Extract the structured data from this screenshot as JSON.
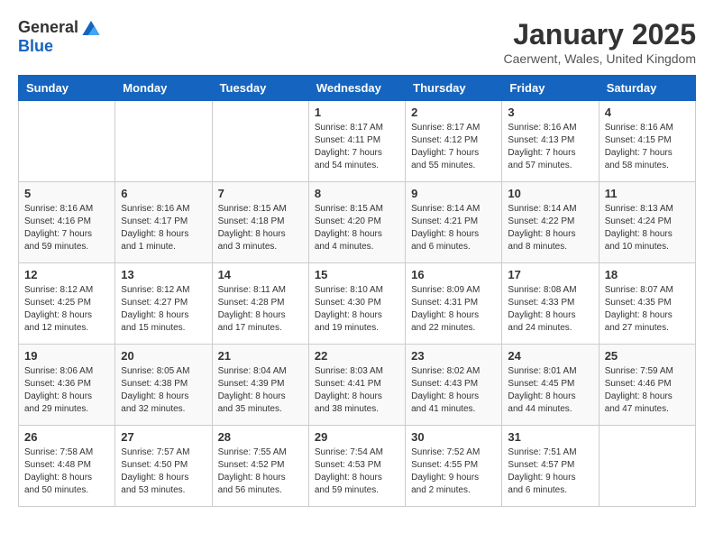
{
  "logo": {
    "general": "General",
    "blue": "Blue"
  },
  "title": "January 2025",
  "location": "Caerwent, Wales, United Kingdom",
  "days_of_week": [
    "Sunday",
    "Monday",
    "Tuesday",
    "Wednesday",
    "Thursday",
    "Friday",
    "Saturday"
  ],
  "weeks": [
    [
      {
        "day": "",
        "info": ""
      },
      {
        "day": "",
        "info": ""
      },
      {
        "day": "",
        "info": ""
      },
      {
        "day": "1",
        "info": "Sunrise: 8:17 AM\nSunset: 4:11 PM\nDaylight: 7 hours\nand 54 minutes."
      },
      {
        "day": "2",
        "info": "Sunrise: 8:17 AM\nSunset: 4:12 PM\nDaylight: 7 hours\nand 55 minutes."
      },
      {
        "day": "3",
        "info": "Sunrise: 8:16 AM\nSunset: 4:13 PM\nDaylight: 7 hours\nand 57 minutes."
      },
      {
        "day": "4",
        "info": "Sunrise: 8:16 AM\nSunset: 4:15 PM\nDaylight: 7 hours\nand 58 minutes."
      }
    ],
    [
      {
        "day": "5",
        "info": "Sunrise: 8:16 AM\nSunset: 4:16 PM\nDaylight: 7 hours\nand 59 minutes."
      },
      {
        "day": "6",
        "info": "Sunrise: 8:16 AM\nSunset: 4:17 PM\nDaylight: 8 hours\nand 1 minute."
      },
      {
        "day": "7",
        "info": "Sunrise: 8:15 AM\nSunset: 4:18 PM\nDaylight: 8 hours\nand 3 minutes."
      },
      {
        "day": "8",
        "info": "Sunrise: 8:15 AM\nSunset: 4:20 PM\nDaylight: 8 hours\nand 4 minutes."
      },
      {
        "day": "9",
        "info": "Sunrise: 8:14 AM\nSunset: 4:21 PM\nDaylight: 8 hours\nand 6 minutes."
      },
      {
        "day": "10",
        "info": "Sunrise: 8:14 AM\nSunset: 4:22 PM\nDaylight: 8 hours\nand 8 minutes."
      },
      {
        "day": "11",
        "info": "Sunrise: 8:13 AM\nSunset: 4:24 PM\nDaylight: 8 hours\nand 10 minutes."
      }
    ],
    [
      {
        "day": "12",
        "info": "Sunrise: 8:12 AM\nSunset: 4:25 PM\nDaylight: 8 hours\nand 12 minutes."
      },
      {
        "day": "13",
        "info": "Sunrise: 8:12 AM\nSunset: 4:27 PM\nDaylight: 8 hours\nand 15 minutes."
      },
      {
        "day": "14",
        "info": "Sunrise: 8:11 AM\nSunset: 4:28 PM\nDaylight: 8 hours\nand 17 minutes."
      },
      {
        "day": "15",
        "info": "Sunrise: 8:10 AM\nSunset: 4:30 PM\nDaylight: 8 hours\nand 19 minutes."
      },
      {
        "day": "16",
        "info": "Sunrise: 8:09 AM\nSunset: 4:31 PM\nDaylight: 8 hours\nand 22 minutes."
      },
      {
        "day": "17",
        "info": "Sunrise: 8:08 AM\nSunset: 4:33 PM\nDaylight: 8 hours\nand 24 minutes."
      },
      {
        "day": "18",
        "info": "Sunrise: 8:07 AM\nSunset: 4:35 PM\nDaylight: 8 hours\nand 27 minutes."
      }
    ],
    [
      {
        "day": "19",
        "info": "Sunrise: 8:06 AM\nSunset: 4:36 PM\nDaylight: 8 hours\nand 29 minutes."
      },
      {
        "day": "20",
        "info": "Sunrise: 8:05 AM\nSunset: 4:38 PM\nDaylight: 8 hours\nand 32 minutes."
      },
      {
        "day": "21",
        "info": "Sunrise: 8:04 AM\nSunset: 4:39 PM\nDaylight: 8 hours\nand 35 minutes."
      },
      {
        "day": "22",
        "info": "Sunrise: 8:03 AM\nSunset: 4:41 PM\nDaylight: 8 hours\nand 38 minutes."
      },
      {
        "day": "23",
        "info": "Sunrise: 8:02 AM\nSunset: 4:43 PM\nDaylight: 8 hours\nand 41 minutes."
      },
      {
        "day": "24",
        "info": "Sunrise: 8:01 AM\nSunset: 4:45 PM\nDaylight: 8 hours\nand 44 minutes."
      },
      {
        "day": "25",
        "info": "Sunrise: 7:59 AM\nSunset: 4:46 PM\nDaylight: 8 hours\nand 47 minutes."
      }
    ],
    [
      {
        "day": "26",
        "info": "Sunrise: 7:58 AM\nSunset: 4:48 PM\nDaylight: 8 hours\nand 50 minutes."
      },
      {
        "day": "27",
        "info": "Sunrise: 7:57 AM\nSunset: 4:50 PM\nDaylight: 8 hours\nand 53 minutes."
      },
      {
        "day": "28",
        "info": "Sunrise: 7:55 AM\nSunset: 4:52 PM\nDaylight: 8 hours\nand 56 minutes."
      },
      {
        "day": "29",
        "info": "Sunrise: 7:54 AM\nSunset: 4:53 PM\nDaylight: 8 hours\nand 59 minutes."
      },
      {
        "day": "30",
        "info": "Sunrise: 7:52 AM\nSunset: 4:55 PM\nDaylight: 9 hours\nand 2 minutes."
      },
      {
        "day": "31",
        "info": "Sunrise: 7:51 AM\nSunset: 4:57 PM\nDaylight: 9 hours\nand 6 minutes."
      },
      {
        "day": "",
        "info": ""
      }
    ]
  ]
}
